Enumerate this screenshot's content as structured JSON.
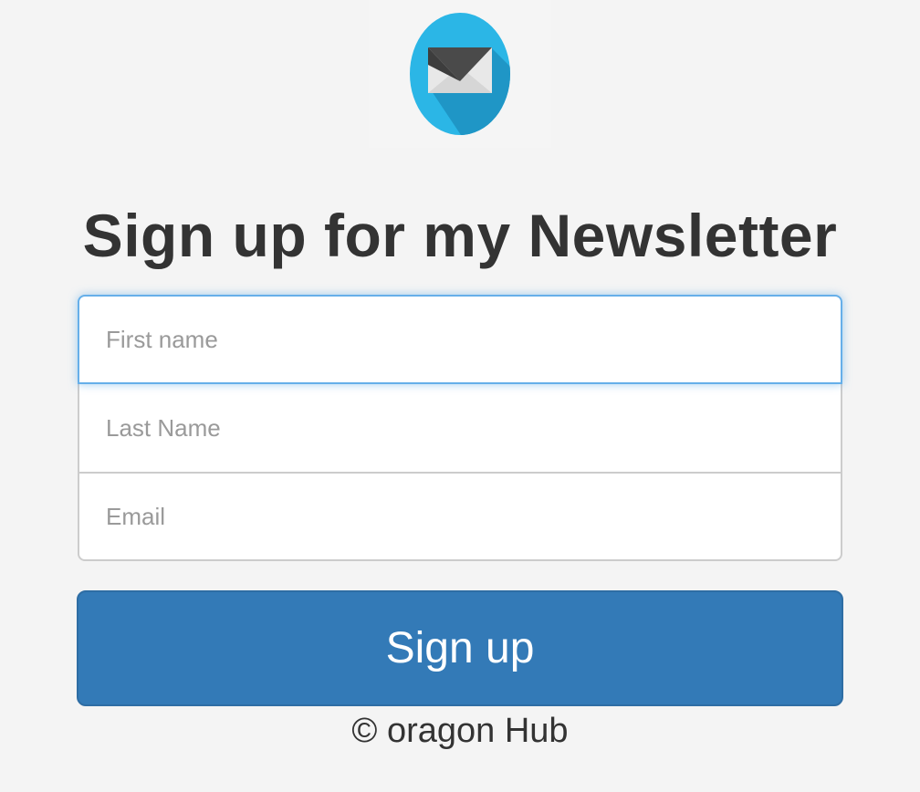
{
  "logo": {
    "icon": "envelope-icon",
    "colors": {
      "circle": "#2bb6e6",
      "shadow": "#1f96c6",
      "flap": "#4a4a4a",
      "paper": "#e8e8e8"
    }
  },
  "title": "Sign up for my Newsletter",
  "form": {
    "first_name": {
      "placeholder": "First name",
      "value": ""
    },
    "last_name": {
      "placeholder": "Last Name",
      "value": ""
    },
    "email": {
      "placeholder": "Email",
      "value": ""
    }
  },
  "signup_button": {
    "label": "Sign up",
    "color": "#337ab7"
  },
  "footer": "© oragon Hub"
}
